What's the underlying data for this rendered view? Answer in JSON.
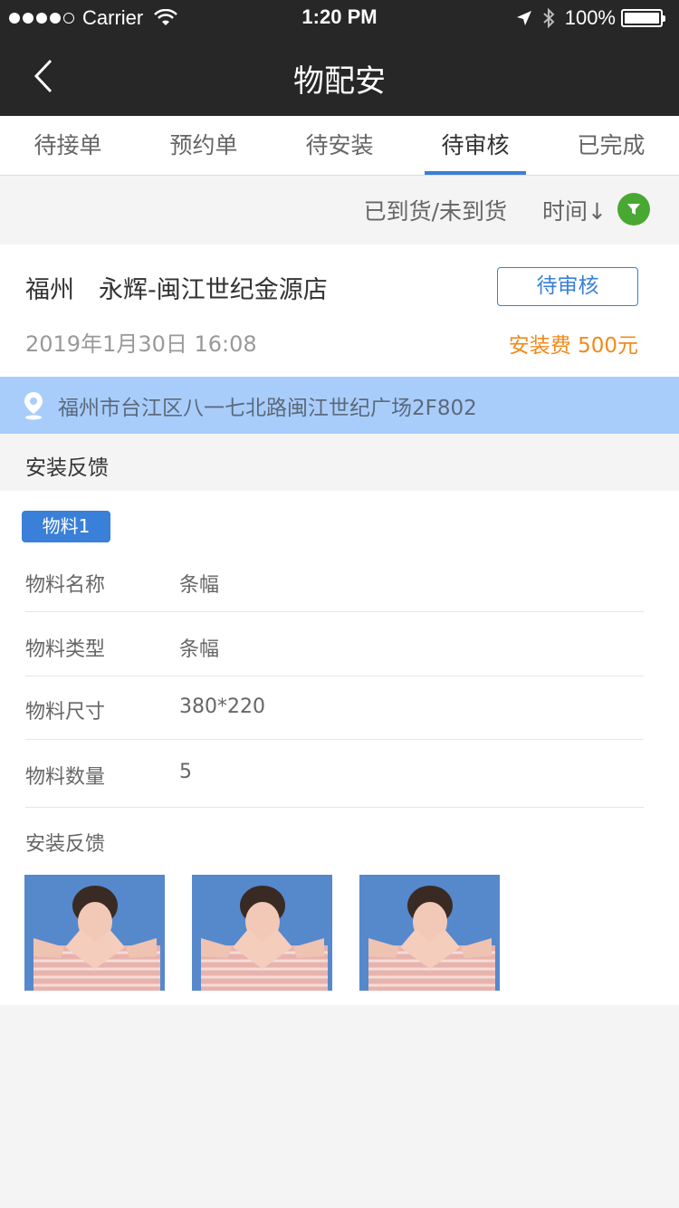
{
  "status_bar": {
    "carrier": "Carrier",
    "time": "1:20 PM",
    "battery": "100%"
  },
  "nav": {
    "title": "物配安"
  },
  "tabs": [
    {
      "label": "待接单"
    },
    {
      "label": "预约单"
    },
    {
      "label": "待安装"
    },
    {
      "label": "待审核"
    },
    {
      "label": "已完成"
    }
  ],
  "active_tab": "待审核",
  "filter": {
    "arrival": "已到货/未到货",
    "time": "时间↓"
  },
  "order": {
    "title": "福州　永辉-闽江世纪金源店",
    "status": "待审核",
    "date": "2019年1月30日 16:08",
    "fee": "安装费 500元"
  },
  "address": "福州市台江区八一七北路闽江世纪广场2F802",
  "section_title": "安装反馈",
  "material": {
    "badge": "物料1",
    "rows": [
      {
        "label": "物料名称",
        "value": "条幅"
      },
      {
        "label": "物料类型",
        "value": "条幅"
      },
      {
        "label": "物料尺寸",
        "value": "380*220"
      },
      {
        "label": "物料数量",
        "value": "5"
      }
    ],
    "feedback_label": "安装反馈"
  },
  "colors": {
    "primary": "#3a7fd8",
    "bar_dark": "#272727",
    "fee_orange": "#f08a1c",
    "filter_green": "#48a832",
    "address_bg": "#a9cdfb"
  }
}
